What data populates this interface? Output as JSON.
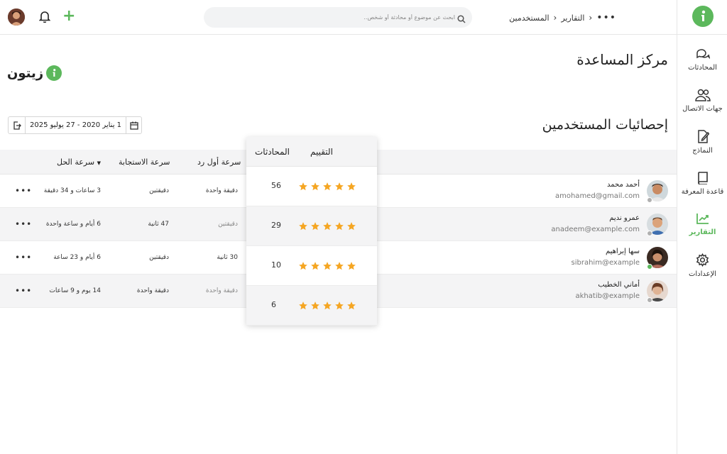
{
  "brand": {
    "name": "زيتون",
    "accent": "#5cb85c"
  },
  "topbar": {
    "search_placeholder": "ابحث عن موضوع أو محادثة أو شخص..",
    "breadcrumb": {
      "root": "التقارير",
      "current": "المستخدمين",
      "more": "•••"
    },
    "add_label": "+"
  },
  "sidebar": {
    "items": [
      {
        "label": "المحادثات",
        "icon": "chat-icon"
      },
      {
        "label": "جهات الاتصال",
        "icon": "contacts-icon"
      },
      {
        "label": "النماذج",
        "icon": "templates-icon"
      },
      {
        "label": "قاعدة المعرفة",
        "icon": "book-icon"
      },
      {
        "label": "التقارير",
        "icon": "chart-icon",
        "active": true
      },
      {
        "label": "الإعدادات",
        "icon": "gear-icon"
      }
    ]
  },
  "page": {
    "title": "مركز المساعدة",
    "section_title": "إحصائيات المستخدمين",
    "date_range": "1 يناير 2020 - 27 يوليو 2025"
  },
  "table": {
    "columns": {
      "first_reply": "سرعة أول رد",
      "response": "سرعة الاستجابة",
      "resolution": "سرعة الحل",
      "rating": "التقييم",
      "conversations": "المحادثات"
    },
    "rows": [
      {
        "name": "أحمد محمد",
        "email": "amohamed@gmail.com",
        "status": "offline",
        "first_reply": "دقيقة واحدة",
        "response": "دقيقتين",
        "resolution": "3 ساعات و 34 دقيقة",
        "conversations": "56",
        "rating": 5
      },
      {
        "name": "عمرو نديم",
        "email": "anadeem@example.com",
        "status": "offline",
        "first_reply": "دقيقتين",
        "response": "47 ثانية",
        "resolution": "6 أيام و ساعة واحدة",
        "conversations": "29",
        "rating": 5
      },
      {
        "name": "سها إبراهيم",
        "email": "sibrahim@example",
        "status": "online",
        "first_reply": "30 ثانية",
        "response": "دقيقتين",
        "resolution": "6 أيام و 23 ساعة",
        "conversations": "10",
        "rating": 5
      },
      {
        "name": "أماني الخطيب",
        "email": "akhatib@example",
        "status": "offline",
        "first_reply": "دقيقة واحدة",
        "response": "دقيقة واحدة",
        "resolution": "14 يوم و 9 ساعات",
        "conversations": "6",
        "rating": 5
      }
    ],
    "more_label": "•••"
  },
  "colors": {
    "star": "#f5a623",
    "online": "#5cb85c",
    "offline": "#b0b0b0"
  }
}
